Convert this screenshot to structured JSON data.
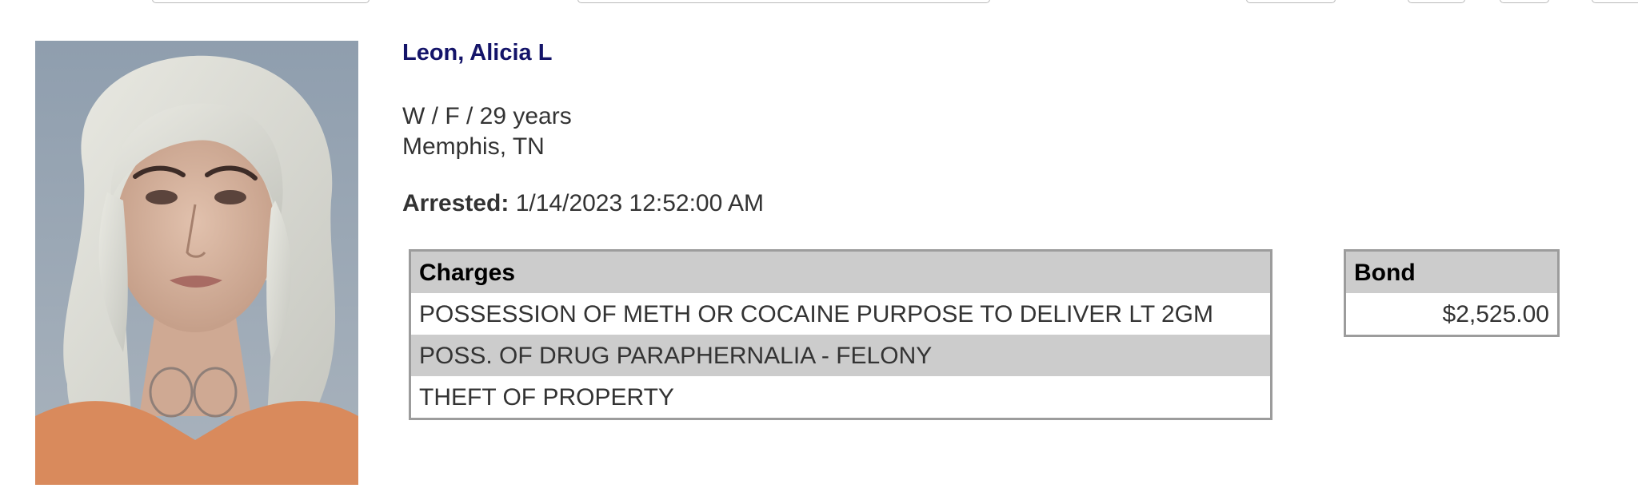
{
  "inmate": {
    "name": "Leon, Alicia L",
    "demographics": "W / F / 29 years",
    "city": "Memphis, TN",
    "arrested_label": "Arrested:",
    "arrested_value": "1/14/2023 12:52:00 AM"
  },
  "charges": {
    "header": "Charges",
    "rows": [
      "POSSESSION OF METH OR COCAINE PURPOSE TO DELIVER LT 2GM",
      "POSS. OF DRUG PARAPHERNALIA - FELONY",
      "THEFT OF PROPERTY"
    ]
  },
  "bond": {
    "header": "Bond",
    "amount": "$2,525.00"
  },
  "colors": {
    "name_color": "#141469",
    "table_header_bg": "#cccccc",
    "table_border": "#9c9c9c"
  }
}
